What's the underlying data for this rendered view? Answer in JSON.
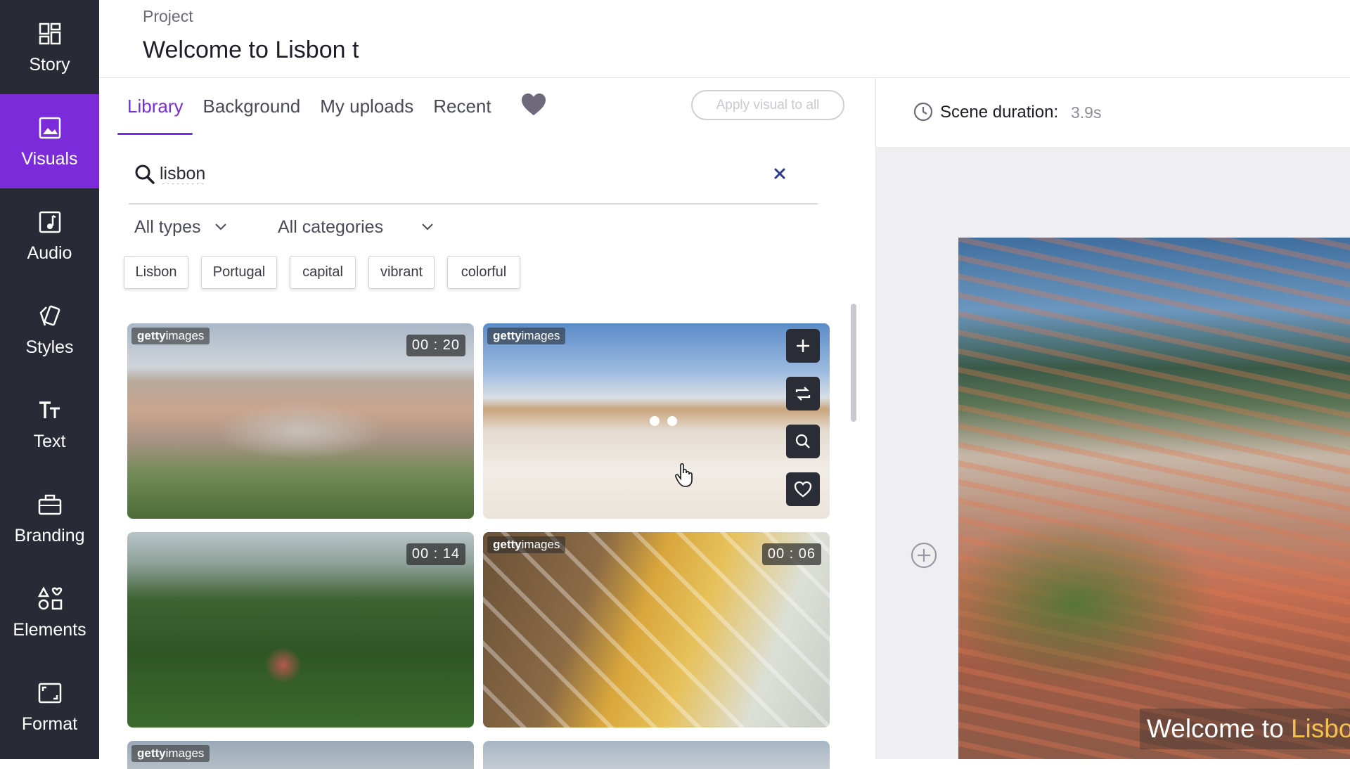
{
  "sidebar": {
    "items": [
      {
        "label": "Story",
        "icon": "grid-icon"
      },
      {
        "label": "Visuals",
        "icon": "image-icon",
        "active": true
      },
      {
        "label": "Audio",
        "icon": "music-note-icon"
      },
      {
        "label": "Styles",
        "icon": "styles-icon"
      },
      {
        "label": "Text",
        "icon": "text-icon"
      },
      {
        "label": "Branding",
        "icon": "briefcase-icon"
      },
      {
        "label": "Elements",
        "icon": "shapes-icon"
      },
      {
        "label": "Format",
        "icon": "format-icon"
      }
    ],
    "colors": {
      "bg": "#282a36",
      "active": "#7b2bd9"
    }
  },
  "header": {
    "project_label": "Project",
    "project_title": "Welcome to Lisbon t"
  },
  "library": {
    "tabs": [
      {
        "label": "Library",
        "active": true
      },
      {
        "label": "Background"
      },
      {
        "label": "My uploads"
      },
      {
        "label": "Recent"
      }
    ],
    "favorites_icon": "heart-icon",
    "apply_button": "Apply visual to all",
    "search": {
      "value": "lisbon",
      "icon": "search-icon",
      "clear_icon": "close-icon"
    },
    "filters": {
      "types": "All types",
      "categories": "All categories"
    },
    "tags": [
      "Lisbon",
      "Portugal",
      "capital",
      "vibrant",
      "colorful"
    ],
    "results": [
      {
        "source_badge": "gettyimages",
        "duration": "00 : 20",
        "scene": "aerial city park"
      },
      {
        "source_badge": "gettyimages",
        "duration": "",
        "scene": "commerce square",
        "hovered": true
      },
      {
        "source_badge": "",
        "duration": "00 : 14",
        "scene": "forest palace"
      },
      {
        "source_badge": "gettyimages",
        "duration": "00 : 06",
        "scene": "azulejo tiles"
      },
      {
        "source_badge": "gettyimages",
        "duration": "",
        "scene": "partial"
      },
      {
        "source_badge": "",
        "duration": "",
        "scene": "partial"
      }
    ],
    "hover_actions": [
      "plus-icon",
      "replace-icon",
      "zoom-icon",
      "heart-outline-icon"
    ]
  },
  "preview": {
    "scene_label": "Scene duration:",
    "scene_value": "3.9s",
    "caption_prefix": "Welcome to",
    "caption_highlight": "Lisbo"
  },
  "colors": {
    "accent": "#7b2bd9",
    "caption_highlight": "#f2c14e"
  }
}
